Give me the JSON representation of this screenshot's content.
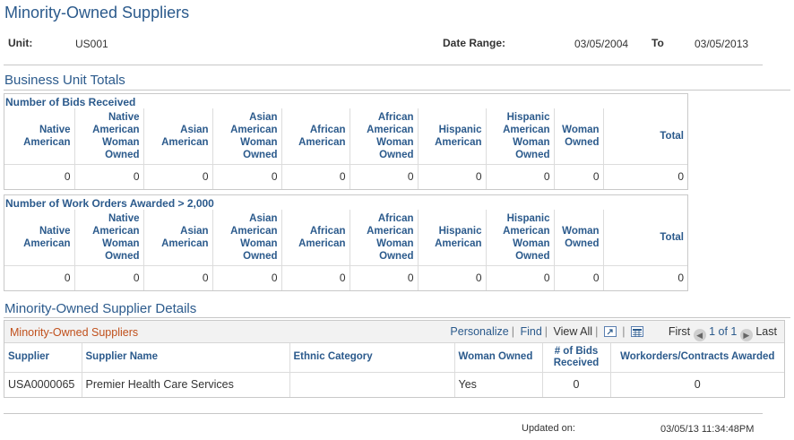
{
  "page": {
    "title": "Minority-Owned Suppliers"
  },
  "header": {
    "unit_label": "Unit:",
    "unit_value": "US001",
    "date_range_label": "Date Range:",
    "date_from": "03/05/2004",
    "to_label": "To",
    "date_to": "03/05/2013"
  },
  "totals": {
    "section_title": "Business Unit Totals",
    "columns": [
      "Native American",
      "Native American Woman Owned",
      "Asian American",
      "Asian American Woman Owned",
      "African American",
      "African American Woman Owned",
      "Hispanic American",
      "Hispanic American Woman Owned",
      "Woman Owned",
      "Total"
    ],
    "bids": {
      "title": "Number of Bids Received",
      "values": [
        "0",
        "0",
        "0",
        "0",
        "0",
        "0",
        "0",
        "0",
        "0",
        "0"
      ]
    },
    "work_orders": {
      "title": "Number of Work Orders Awarded > 2,000",
      "values": [
        "0",
        "0",
        "0",
        "0",
        "0",
        "0",
        "0",
        "0",
        "0",
        "0"
      ]
    }
  },
  "details": {
    "section_title": "Minority-Owned Supplier Details",
    "grid_title": "Minority-Owned Suppliers",
    "nav": {
      "personalize": "Personalize",
      "find": "Find",
      "view_all": "View All",
      "first": "First",
      "range": "1 of 1",
      "last": "Last"
    },
    "columns": [
      "Supplier",
      "Supplier Name",
      "Ethnic Category",
      "Woman Owned",
      "# of Bids Received",
      "Workorders/Contracts Awarded"
    ],
    "rows": [
      {
        "supplier": "USA0000065",
        "name": "Premier Health Care Services",
        "ethnic": "",
        "woman_owned": "Yes",
        "bids": "0",
        "awarded": "0"
      }
    ]
  },
  "footer": {
    "updated_label": "Updated on:",
    "updated_value": "03/05/13 11:34:48PM"
  }
}
